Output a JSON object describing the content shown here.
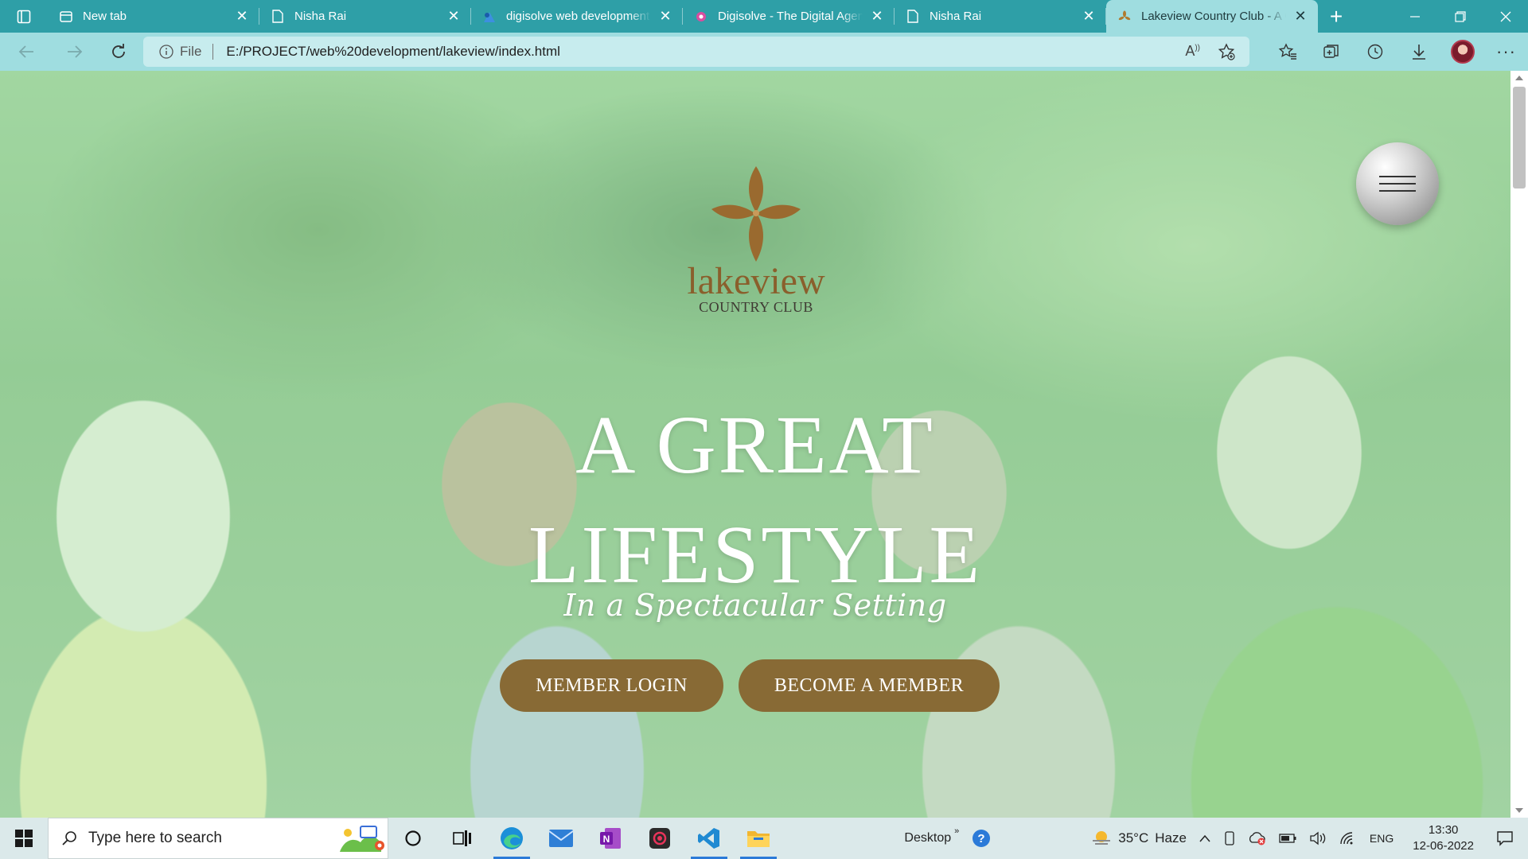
{
  "browser": {
    "tabs": [
      {
        "title": "New tab",
        "icon": "newtab-icon",
        "active": false
      },
      {
        "title": "Nisha Rai",
        "icon": "page-icon",
        "active": false
      },
      {
        "title": "digisolve web development",
        "icon": "digisolve-icon",
        "active": false
      },
      {
        "title": "Digisolve - The Digital Agency",
        "icon": "digisolve-agency-icon",
        "active": false
      },
      {
        "title": "Nisha Rai",
        "icon": "page-icon",
        "active": false
      },
      {
        "title": "Lakeview Country Club - A Great Lifestyle",
        "icon": "lakeview-icon",
        "active": true
      }
    ],
    "address": {
      "security_label": "File",
      "url": "E:/PROJECT/web%20development/lakeview/index.html"
    }
  },
  "page": {
    "logo": {
      "word": "lakeview",
      "subtitle": "COUNTRY CLUB"
    },
    "headline": {
      "line1": "A GREAT",
      "line2": "LIFESTYLE"
    },
    "tagline": "In a Spectacular Setting",
    "buttons": {
      "login": "MEMBER LOGIN",
      "member": "BECOME A MEMBER"
    },
    "colors": {
      "brand_brown": "#886a35",
      "tab_strip": "#2e9fa7",
      "toolbar": "#9fdde0"
    }
  },
  "taskbar": {
    "search_placeholder": "Type here to search",
    "desktop_label": "Desktop",
    "weather": {
      "temp": "35°C",
      "condition": "Haze"
    },
    "language": "ENG",
    "clock": {
      "time": "13:30",
      "date": "12-06-2022"
    }
  }
}
